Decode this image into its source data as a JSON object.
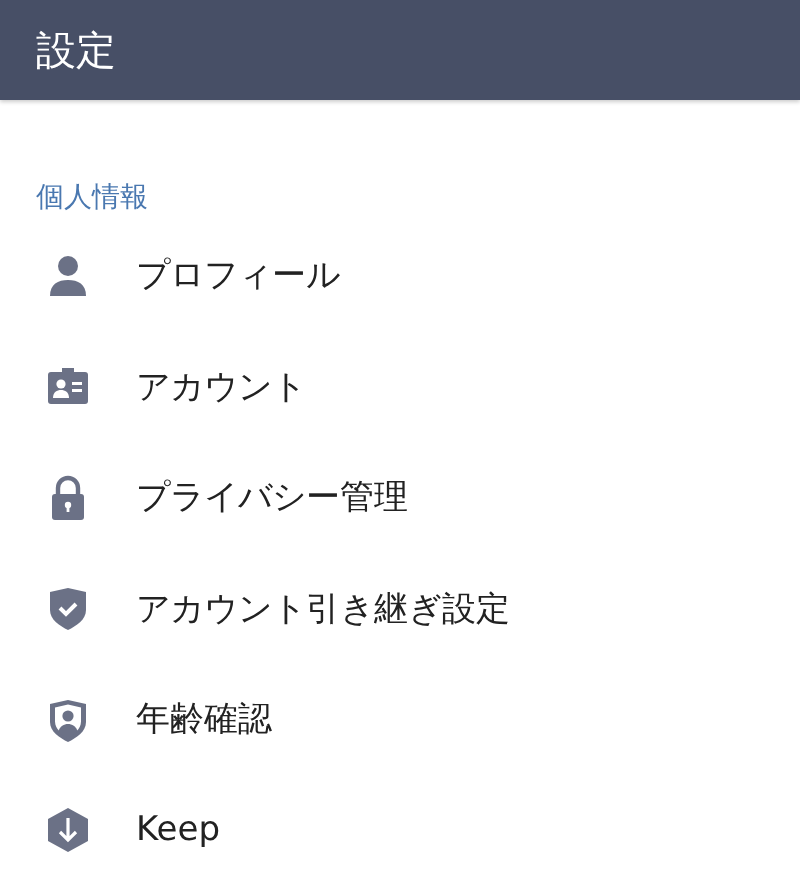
{
  "header": {
    "title": "設定"
  },
  "section": {
    "title": "個人情報"
  },
  "items": [
    {
      "kind": "person",
      "label": "プロフィール"
    },
    {
      "kind": "card",
      "label": "アカウント"
    },
    {
      "kind": "lock",
      "label": "プライバシー管理"
    },
    {
      "kind": "shield-check",
      "label": "アカウント引き継ぎ設定"
    },
    {
      "kind": "shield-person",
      "label": "年齢確認"
    },
    {
      "kind": "hex-arrow",
      "label": "Keep"
    }
  ]
}
